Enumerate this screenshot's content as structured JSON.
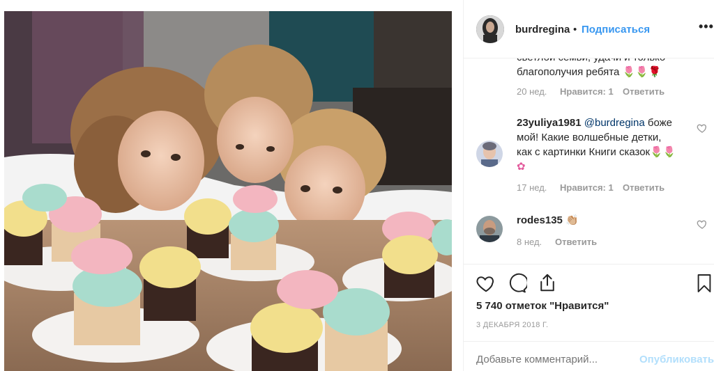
{
  "header": {
    "username": "burdregina",
    "separator": "•",
    "follow_label": "Подписаться",
    "more_icon": "more-dots-icon",
    "more_label": "•••"
  },
  "comments": [
    {
      "text_line1": "светлой семьи, удачи и только",
      "text_line2": "благополучия ребята 🌷🌷🌹",
      "age": "20 нед.",
      "likes": "Нравится: 1",
      "reply": "Ответить"
    },
    {
      "username": "23yuliya1981",
      "mention": "@burdregina",
      "text_l1_rest": " боже",
      "text_l2": "мой! Какие волшебные детки,",
      "text_l3": "как с картинки Книги сказок🌷🌷",
      "text_l4": "✿",
      "age": "17 нед.",
      "likes": "Нравится: 1",
      "reply": "Ответить"
    },
    {
      "username": "rodes135",
      "emoji": "👏🏼",
      "age": "8 нед.",
      "reply": "Ответить"
    }
  ],
  "actions": {
    "like_icon": "heart-icon",
    "comment_icon": "comment-icon",
    "share_icon": "share-icon",
    "save_icon": "bookmark-icon"
  },
  "likes_text": "5 740 отметок \"Нравится\"",
  "date": "3 ДЕКАБРЯ 2018 Г.",
  "add_comment": {
    "placeholder": "Добавьте комментарий...",
    "publish_label": "Опубликовать"
  },
  "colors": {
    "accent": "#3897f0",
    "publish_disabled": "#b2dffc",
    "muted": "#999999"
  }
}
